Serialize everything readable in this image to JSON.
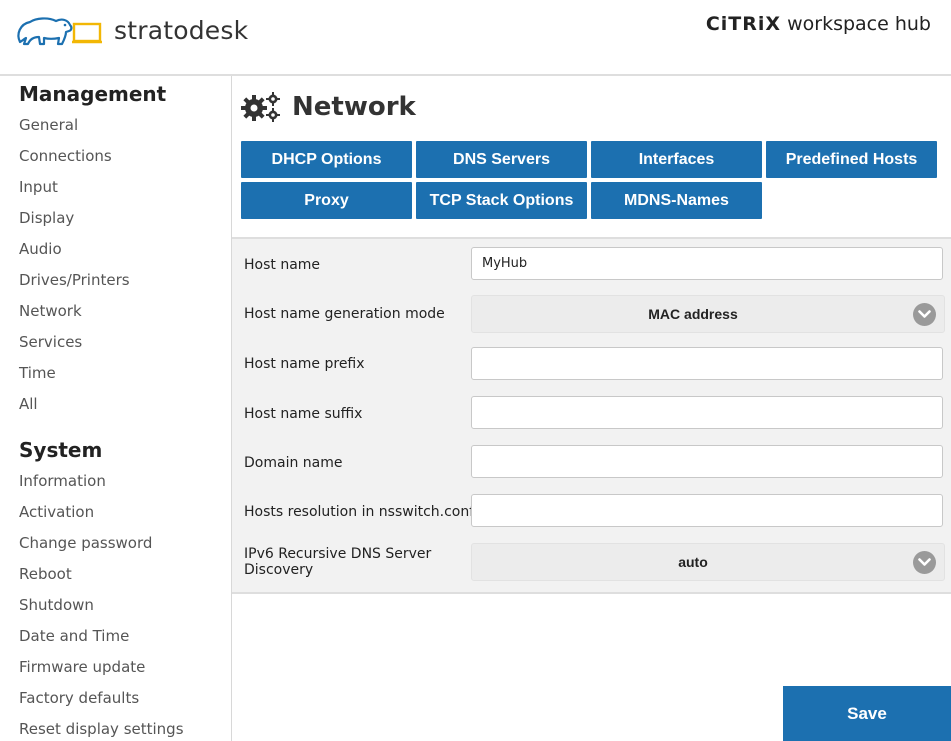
{
  "header": {
    "logo_text": "stratodesk",
    "citrix_brand": "CiTRiX",
    "citrix_product": "workspace hub"
  },
  "sidebar": {
    "management_title": "Management",
    "management_items": [
      {
        "label": "General"
      },
      {
        "label": "Connections"
      },
      {
        "label": "Input"
      },
      {
        "label": "Display"
      },
      {
        "label": "Audio"
      },
      {
        "label": "Drives/Printers"
      },
      {
        "label": "Network"
      },
      {
        "label": "Services"
      },
      {
        "label": "Time"
      },
      {
        "label": "All"
      }
    ],
    "system_title": "System",
    "system_items": [
      {
        "label": "Information"
      },
      {
        "label": "Activation"
      },
      {
        "label": "Change password"
      },
      {
        "label": "Reboot"
      },
      {
        "label": "Shutdown"
      },
      {
        "label": "Date and Time"
      },
      {
        "label": "Firmware update"
      },
      {
        "label": "Factory defaults"
      },
      {
        "label": "Reset display settings"
      }
    ]
  },
  "main": {
    "title": "Network",
    "title_icon": "gears-icon",
    "tabs": [
      {
        "label": "DHCP Options"
      },
      {
        "label": "DNS Servers"
      },
      {
        "label": "Interfaces"
      },
      {
        "label": "Predefined Hosts"
      },
      {
        "label": "Proxy"
      },
      {
        "label": "TCP Stack Options"
      },
      {
        "label": "MDNS-Names"
      }
    ],
    "form": {
      "host_name": {
        "label": "Host name",
        "value": "MyHub"
      },
      "host_name_generation_mode": {
        "label": "Host name generation mode",
        "value": "MAC address"
      },
      "host_name_prefix": {
        "label": "Host name prefix",
        "value": ""
      },
      "host_name_suffix": {
        "label": "Host name suffix",
        "value": ""
      },
      "domain_name": {
        "label": "Domain name",
        "value": ""
      },
      "hosts_resolution": {
        "label": "Hosts resolution in nsswitch.conf",
        "value": ""
      },
      "ipv6_rdnss": {
        "label_line1": "IPv6 Recursive DNS Server",
        "label_line2": "Discovery",
        "value": "auto"
      }
    },
    "save_label": "Save"
  },
  "colors": {
    "accent": "#1c70b0",
    "logo_bear": "#1c70b0",
    "logo_screen": "#f2b705",
    "panel_bg": "#f2f2f2"
  }
}
